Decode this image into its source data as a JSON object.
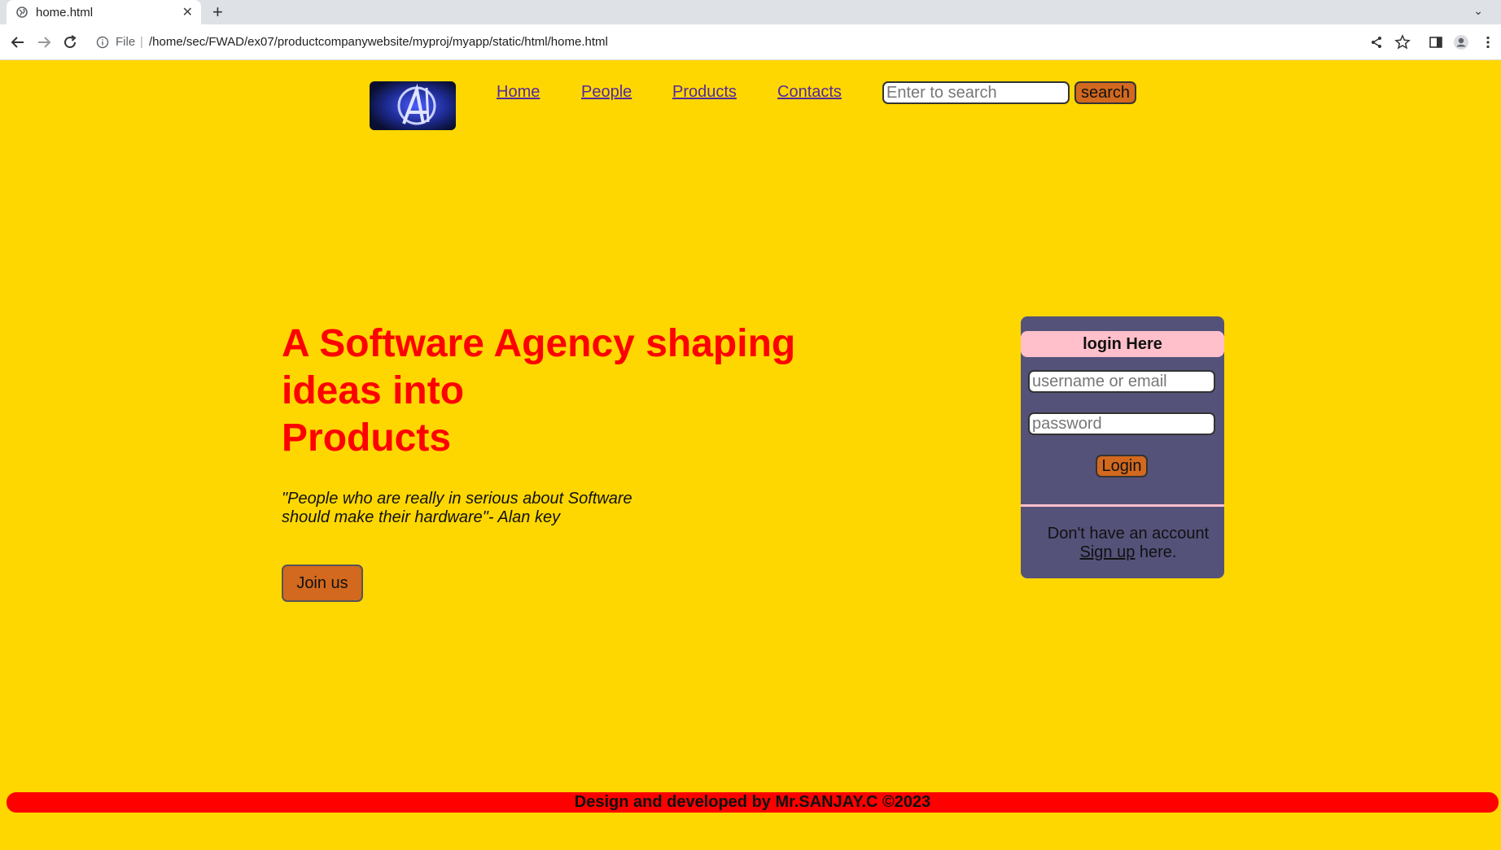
{
  "browser": {
    "tab_title": "home.html",
    "address_scheme": "File",
    "address_url": "/home/sec/FWAD/ex07/productcompanywebsite/myproj/myapp/static/html/home.html"
  },
  "header": {
    "nav": [
      "Home",
      "People",
      "Products",
      "Contacts"
    ],
    "search_placeholder": "Enter to search",
    "search_button": "search"
  },
  "hero": {
    "title_line1": "A Software Agency shaping",
    "title_line2": "ideas into",
    "title_line3": "Products",
    "quote_line1": "\"People who are really in serious about Software",
    "quote_line2": "should make their hardware\"- Alan key",
    "join_button": "Join us"
  },
  "login": {
    "heading": "login Here",
    "username_placeholder": "username or email",
    "password_placeholder": "password",
    "login_button": "Login",
    "signup_prefix": "Don't have an account",
    "signup_link": "Sign up",
    "signup_suffix": " here."
  },
  "footer": {
    "text": "Design and developed by Mr.SANJAY.C ©2023"
  },
  "colors": {
    "page_bg": "#ffd700",
    "accent_button": "#d2691e",
    "hero_title": "#ff0000",
    "login_panel": "#55527a",
    "login_header": "#ffc0cb",
    "footer_bg": "#ff0000",
    "nav_link": "#552a9a"
  }
}
